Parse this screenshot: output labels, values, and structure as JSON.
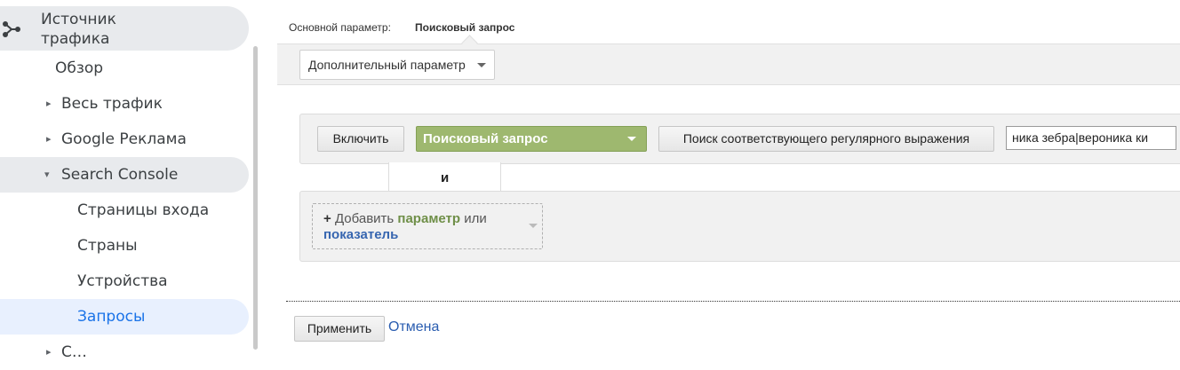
{
  "sidebar": {
    "parent": {
      "label_line1": "Источник",
      "label_line2": "трафика",
      "icon": "merge-icon"
    },
    "items": [
      {
        "label": "Обзор"
      },
      {
        "label": "Весь трафик",
        "caret": "▸"
      },
      {
        "label": "Google Реклама",
        "caret": "▸"
      },
      {
        "label": "Search Console",
        "caret": "▾"
      },
      {
        "label": "Страницы входа"
      },
      {
        "label": "Страны"
      },
      {
        "label": "Устройства"
      },
      {
        "label": "Запросы"
      },
      {
        "label": "С…",
        "caret": "▸"
      }
    ]
  },
  "primary_dimension": {
    "label": "Основной параметр:",
    "value": "Поисковый запрос"
  },
  "secondary_dimension": {
    "label": "Дополнительный параметр"
  },
  "filter": {
    "include_label": "Включить",
    "dimension_label": "Поисковый запрос",
    "match_label": "Поиск соответствующего регулярного выражения",
    "regex_value": "ника зебра|вероника ки",
    "and_label": "и",
    "add_plus": "+",
    "add_text": "Добавить",
    "add_param": "параметр",
    "add_or": "или",
    "add_metric": "показатель"
  },
  "actions": {
    "apply_label": "Применить",
    "cancel_label": "Отмена"
  },
  "colors": {
    "dimension_green": "#9eb86f",
    "link_blue": "#2a5db0",
    "selected_bg": "#e8f0fe"
  }
}
